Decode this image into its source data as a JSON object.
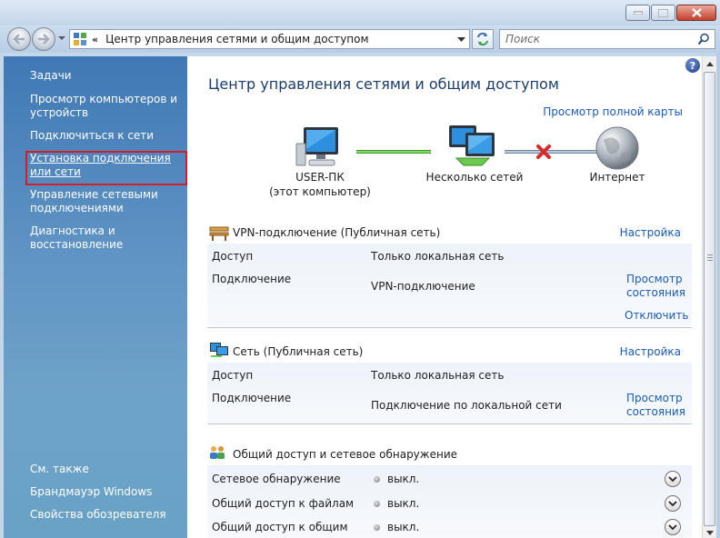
{
  "window": {
    "buttons": [
      "minimize",
      "maximize",
      "close"
    ]
  },
  "address": {
    "chevron": "«",
    "path": "Центр управления сетями и общим доступом",
    "search_placeholder": "Поиск"
  },
  "sidebar": {
    "tasks_header": "Задачи",
    "tasks": [
      "Просмотр компьютеров и устройств",
      "Подключиться к сети",
      "Установка подключения или сети",
      "Управление сетевыми подключениями",
      "Диагностика и восстановление"
    ],
    "see_also_header": "См. также",
    "see_also": [
      "Брандмауэр Windows",
      "Свойства обозревателя"
    ]
  },
  "main": {
    "help": "?",
    "title": "Центр управления сетями и общим доступом",
    "full_map_link": "Просмотр полной карты",
    "network_map": {
      "computer_name": "USER-ПК",
      "computer_sub": "(этот компьютер)",
      "middle": "Несколько сетей",
      "internet": "Интернет"
    },
    "vpn": {
      "name": "VPN-подключение (Публичная сеть)",
      "settings": "Настройка",
      "access_label": "Доступ",
      "access_value": "Только локальная сеть",
      "connection_label": "Подключение",
      "connection_value": "VPN-подключение",
      "status_link_1": "Просмотр",
      "status_link_2": "состояния",
      "disconnect": "Отключить"
    },
    "lan": {
      "name": "Сеть (Публичная сеть)",
      "settings": "Настройка",
      "access_label": "Доступ",
      "access_value": "Только локальная сеть",
      "connection_label": "Подключение",
      "connection_value": "Подключение по локальной сети",
      "status_link_1": "Просмотр",
      "status_link_2": "состояния"
    },
    "sharing": {
      "title": "Общий доступ и сетевое обнаружение",
      "rows": [
        {
          "label": "Сетевое обнаружение",
          "state": "выкл."
        },
        {
          "label": "Общий доступ к файлам",
          "state": "выкл."
        },
        {
          "label": "Общий доступ к общим",
          "state": "выкл."
        }
      ]
    }
  },
  "colors": {
    "accent_link": "#1a5bb5",
    "highlight_box": "#d21d2b",
    "sidebar_top": "#3f78b5"
  },
  "icons": [
    "back-arrow-icon",
    "forward-arrow-icon",
    "control-panel-icon",
    "refresh-icon",
    "search-icon",
    "help-icon",
    "computer-icon",
    "networks-icon",
    "globe-icon",
    "disconnected-x-icon",
    "vpn-bench-icon",
    "network-monitors-icon",
    "sharing-icon",
    "expand-chevron-icon"
  ]
}
